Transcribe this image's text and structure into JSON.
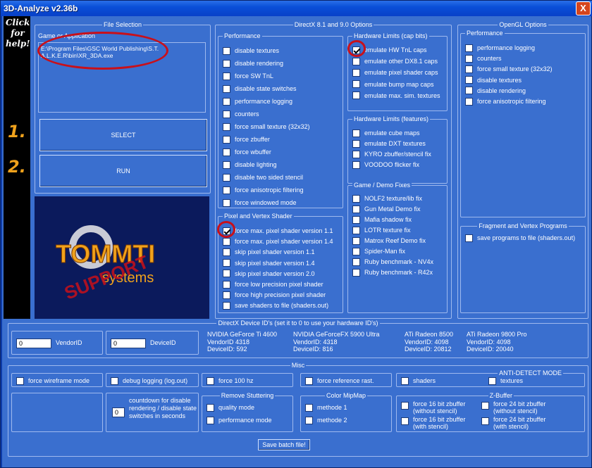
{
  "window": {
    "title": "3D-Analyze v2.36b",
    "close": "X"
  },
  "sidebar": {
    "help": "Click for help!",
    "step1": "1.",
    "step2": "2."
  },
  "file_selection": {
    "title": "File Selection",
    "label": "Game or Application",
    "path": "E:\\Program Files\\GSC World Publishing\\S.T.A.L.K.E.R\\bin\\XR_3DA.exe",
    "select": "SELECT",
    "run": "RUN"
  },
  "logo": {
    "main": "TOMMTI",
    "sub": "systems",
    "stamp": "SUPPORT"
  },
  "dx": {
    "title": "DirectX 8.1 and 9.0 Options",
    "performance": {
      "title": "Performance",
      "items": [
        {
          "label": "disable textures",
          "checked": false
        },
        {
          "label": "disable rendering",
          "checked": false
        },
        {
          "label": "force SW TnL",
          "checked": false
        },
        {
          "label": "disable state switches",
          "checked": false
        },
        {
          "label": "performance logging",
          "checked": false
        },
        {
          "label": "counters",
          "checked": false
        },
        {
          "label": "force small texture (32x32)",
          "checked": false
        },
        {
          "label": "force zbuffer",
          "checked": false
        },
        {
          "label": "force wbuffer",
          "checked": false
        },
        {
          "label": "disable lighting",
          "checked": false
        },
        {
          "label": "disable two sided stencil",
          "checked": false
        },
        {
          "label": "force anisotropic filtering",
          "checked": false
        },
        {
          "label": "force windowed mode",
          "checked": false
        }
      ]
    },
    "shader": {
      "title": "Pixel and Vertex Shader",
      "items": [
        {
          "label": "force max. pixel shader version 1.1",
          "checked": true
        },
        {
          "label": "force max. pixel shader version 1.4",
          "checked": false
        },
        {
          "label": "skip pixel shader version 1.1",
          "checked": false
        },
        {
          "label": "skip pixel shader version 1.4",
          "checked": false
        },
        {
          "label": "skip pixel shader version 2.0",
          "checked": false
        },
        {
          "label": "force low precision pixel shader",
          "checked": false
        },
        {
          "label": "force high precision pixel shader",
          "checked": false
        },
        {
          "label": "save shaders to file (shaders.out)",
          "checked": false
        }
      ]
    },
    "caps": {
      "title": "Hardware Limits (cap bits)",
      "items": [
        {
          "label": "emulate HW TnL caps",
          "checked": true
        },
        {
          "label": "emulate other DX8.1 caps",
          "checked": false
        },
        {
          "label": "emulate pixel shader caps",
          "checked": false
        },
        {
          "label": "emulate bump map caps",
          "checked": false
        },
        {
          "label": "emulate max. sim. textures",
          "checked": false
        }
      ]
    },
    "features": {
      "title": "Hardware Limits (features)",
      "items": [
        {
          "label": "emulate cube maps",
          "checked": false
        },
        {
          "label": "emulate DXT textures",
          "checked": false
        },
        {
          "label": "KYRO zbuffer/stencil fix",
          "checked": false
        },
        {
          "label": "VOODOO flicker fix",
          "checked": false
        }
      ]
    },
    "fixes": {
      "title": "Game / Demo Fixes",
      "items": [
        {
          "label": "NOLF2 texture/lib fix",
          "checked": false
        },
        {
          "label": "Gun Metal Demo fix",
          "checked": false
        },
        {
          "label": "Mafia shadow fix",
          "checked": false
        },
        {
          "label": "LOTR texture fix",
          "checked": false
        },
        {
          "label": "Matrox Reef Demo fix",
          "checked": false
        },
        {
          "label": "Spider-Man fix",
          "checked": false
        },
        {
          "label": "Ruby benchmark - NV4x",
          "checked": false
        },
        {
          "label": "Ruby benchmark - R42x",
          "checked": false
        }
      ]
    }
  },
  "opengl": {
    "title": "OpenGL Options",
    "performance": {
      "title": "Performance",
      "items": [
        {
          "label": "performance logging",
          "checked": false
        },
        {
          "label": "counters",
          "checked": false
        },
        {
          "label": "force small texture (32x32)",
          "checked": false
        },
        {
          "label": "disable textures",
          "checked": false
        },
        {
          "label": "disable rendering",
          "checked": false
        },
        {
          "label": "force anisotropic filtering",
          "checked": false
        }
      ]
    },
    "programs": {
      "title": "Fragment and Vertex Programs",
      "items": [
        {
          "label": "save programs to file (shaders.out)",
          "checked": false
        }
      ]
    }
  },
  "device": {
    "title": "DirectX Device ID's (set it to 0 to use your hardware ID's)",
    "vendor_value": "0",
    "vendor_label": "VendorID",
    "device_value": "0",
    "device_label": "DeviceID",
    "cards": [
      {
        "name": "NVIDIA GeForce Ti 4600",
        "vendor": "VendorID 4318",
        "device": "DeviceID: 592"
      },
      {
        "name": "NVIDIA GeForceFX 5900 Ultra",
        "vendor": "VendorID: 4318",
        "device": "DeviceID: 816"
      },
      {
        "name": "ATi Radeon 8500",
        "vendor": "VendorID: 4098",
        "device": "DeviceID: 20812"
      },
      {
        "name": "ATi Radeon 9800 Pro",
        "vendor": "VendorID: 4098",
        "device": "DeviceID: 20040"
      }
    ]
  },
  "misc": {
    "title": "Misc",
    "wireframe": "force wireframe mode",
    "debug": "debug logging (log.out)",
    "hz": "force 100 hz",
    "refrast": "force reference rast.",
    "antidetect": {
      "title": "ANTI-DETECT MODE",
      "shaders": "shaders",
      "textures": "textures"
    },
    "countdown_value": "0",
    "countdown_label": "countdown for disable rendering / disable state switches in seconds",
    "stutter": {
      "title": "Remove Stuttering",
      "quality": "quality mode",
      "performance": "performance mode"
    },
    "mipmap": {
      "title": "Color MipMap",
      "m1": "methode 1",
      "m2": "methode 2"
    },
    "zbuffer": {
      "title": "Z-Buffer",
      "z16a": "force 16 bit zbuffer",
      "z16a_sub": "(without stencil)",
      "z16b": "force 16 bit zbuffer",
      "z16b_sub": "(with stencil)",
      "z24a": "force 24 bit zbuffer",
      "z24a_sub": "(without stencil)",
      "z24b": "force 24 bit zbuffer",
      "z24b_sub": "(with stencil)"
    },
    "save_batch": "Save batch file!"
  }
}
